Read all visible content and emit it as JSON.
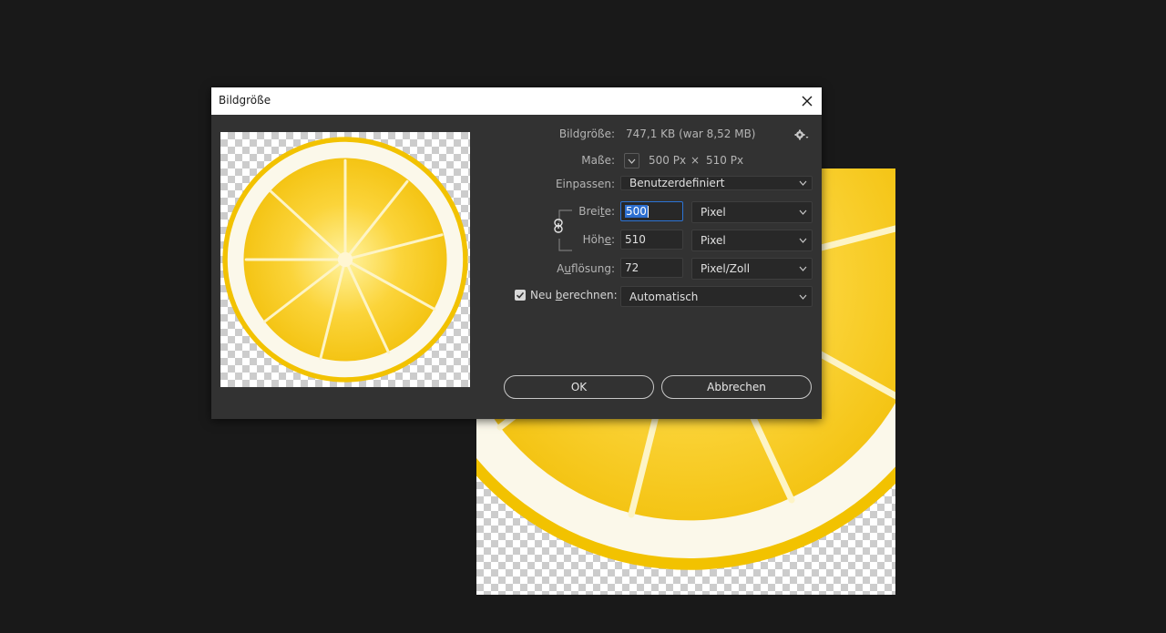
{
  "dialog": {
    "title": "Bildgröße",
    "image_size_label": "Bildgröße:",
    "image_size_value": "747,1 KB (war 8,52 MB)",
    "dimensions_label": "Maße:",
    "dimensions_width": "500 Px",
    "dimensions_sep": "×",
    "dimensions_height": "510 Px",
    "fit_label": "Einpassen:",
    "fit_value": "Benutzerdefiniert",
    "width_label_a": "Brei",
    "width_label_u": "t",
    "width_label_b": "e:",
    "width_value": "500",
    "width_unit": "Pixel",
    "height_label_a": "Höh",
    "height_label_u": "e",
    "height_label_b": ":",
    "height_value": "510",
    "height_unit": "Pixel",
    "resolution_label_a": "A",
    "resolution_label_u": "u",
    "resolution_label_b": "flösung:",
    "resolution_value": "72",
    "resolution_unit": "Pixel/Zoll",
    "resample_label_a": "Neu ",
    "resample_label_u": "b",
    "resample_label_b": "erechnen:",
    "resample_checked": true,
    "resample_value": "Automatisch",
    "ok_label": "OK",
    "cancel_label": "Abbrechen"
  },
  "icons": {
    "close": "close-icon",
    "settings": "gear-icon",
    "chain": "chain-link-icon",
    "chevron": "chevron-down-icon"
  },
  "colors": {
    "background": "#191919",
    "dialog": "#323232",
    "accent": "#2c74d6"
  }
}
